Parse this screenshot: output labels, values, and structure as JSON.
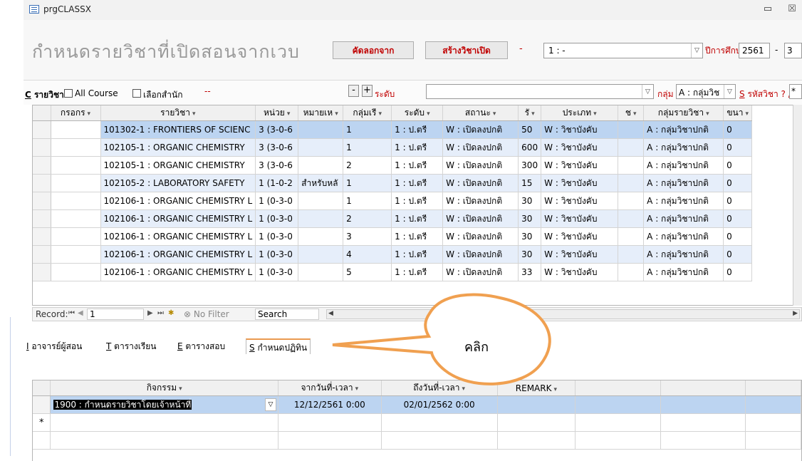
{
  "window": {
    "title": "prgCLASSX",
    "minimize_glyph": "▭",
    "close_glyph": "☒"
  },
  "header": {
    "title": "กำหนดรายวิชาที่เปิดสอนจากเวบ",
    "copy_button": "คัดลอกจาก",
    "create_button": "สร้างวิชาเปิด",
    "dash": "-",
    "combo_value": "1 : -",
    "year_label": "ปีการศึกษา",
    "year_value": "2561",
    "year_dash": "-",
    "term_value": "3"
  },
  "filters": {
    "subject_label_key": "C",
    "subject_label": " รายวิชา",
    "all_course": "All Course",
    "select_office": "เลือกสำนัก",
    "office_value": "--",
    "minus": "-",
    "plus": "+",
    "level_label": "ระดับ",
    "level_value": "",
    "group_label": "กลุ่ม",
    "group_value": "A : กลุ่มวิช",
    "code_label_key": "S",
    "code_label": " รหัสวิชา ? /*",
    "code_value": "*"
  },
  "grid": {
    "columns": [
      "กรอกร",
      "รายวิชา",
      "หน่วย",
      "หมายเห",
      "กลุ่มเรี",
      "ระดับ",
      "สถานะ",
      "รั",
      "ประเภท",
      "ช",
      "กลุ่มรายวิชา",
      "ขนา"
    ],
    "rows": [
      [
        "",
        "101302-1 : FRONTIERS OF SCIENC",
        "3 (3-0-6",
        "",
        "1",
        "1 : ป.ตรี",
        "W : เปิดลงปกติ",
        "50",
        "W : วิชาบังคับ",
        "",
        "A : กลุ่มวิชาปกติ",
        "0"
      ],
      [
        "",
        "102105-1 : ORGANIC CHEMISTRY",
        "3 (3-0-6",
        "",
        "1",
        "1 : ป.ตรี",
        "W : เปิดลงปกติ",
        "600",
        "W : วิชาบังคับ",
        "",
        "A : กลุ่มวิชาปกติ",
        "0"
      ],
      [
        "",
        "102105-1 : ORGANIC CHEMISTRY",
        "3 (3-0-6",
        "",
        "2",
        "1 : ป.ตรี",
        "W : เปิดลงปกติ",
        "300",
        "W : วิชาบังคับ",
        "",
        "A : กลุ่มวิชาปกติ",
        "0"
      ],
      [
        "",
        "102105-2 : LABORATORY SAFETY",
        "1 (1-0-2",
        "สำหรับหลั",
        "1",
        "1 : ป.ตรี",
        "W : เปิดลงปกติ",
        "15",
        "W : วิชาบังคับ",
        "",
        "A : กลุ่มวิชาปกติ",
        "0"
      ],
      [
        "",
        "102106-1 : ORGANIC CHEMISTRY L",
        "1 (0-3-0",
        "",
        "1",
        "1 : ป.ตรี",
        "W : เปิดลงปกติ",
        "30",
        "W : วิชาบังคับ",
        "",
        "A : กลุ่มวิชาปกติ",
        "0"
      ],
      [
        "",
        "102106-1 : ORGANIC CHEMISTRY L",
        "1 (0-3-0",
        "",
        "2",
        "1 : ป.ตรี",
        "W : เปิดลงปกติ",
        "30",
        "W : วิชาบังคับ",
        "",
        "A : กลุ่มวิชาปกติ",
        "0"
      ],
      [
        "",
        "102106-1 : ORGANIC CHEMISTRY L",
        "1 (0-3-0",
        "",
        "3",
        "1 : ป.ตรี",
        "W : เปิดลงปกติ",
        "30",
        "W : วิชาบังคับ",
        "",
        "A : กลุ่มวิชาปกติ",
        "0"
      ],
      [
        "",
        "102106-1 : ORGANIC CHEMISTRY L",
        "1 (0-3-0",
        "",
        "4",
        "1 : ป.ตรี",
        "W : เปิดลงปกติ",
        "30",
        "W : วิชาบังคับ",
        "",
        "A : กลุ่มวิชาปกติ",
        "0"
      ],
      [
        "",
        "102106-1 : ORGANIC CHEMISTRY L",
        "1 (0-3-0",
        "",
        "5",
        "1 : ป.ตรี",
        "W : เปิดลงปกติ",
        "33",
        "W : วิชาบังคับ",
        "",
        "A : กลุ่มวิชาปกติ",
        "0"
      ]
    ]
  },
  "record_nav": {
    "label": "Record:",
    "current": "1",
    "no_filter": "No Filter",
    "search": "Search"
  },
  "tabs": [
    {
      "key": "I",
      "label": " อาจารย์ผู้สอน"
    },
    {
      "key": "T",
      "label": " ตารางเรียน"
    },
    {
      "key": "E",
      "label": " ตารางสอบ"
    },
    {
      "key": "S",
      "label": " กำหนดปฏิทิน"
    }
  ],
  "schedule": {
    "columns": [
      "กิจกรรม",
      "จากวันที่-เวลา",
      "ถึงวันที่-เวลา",
      "REMARK"
    ],
    "rows": [
      [
        "1900 : กำหนดรายวิชาโดยเจ้าหน้าที่",
        "12/12/2561 0:00",
        "02/01/2562 0:00",
        ""
      ]
    ],
    "new_row_marker": "*"
  },
  "callout": {
    "text": "คลิก",
    "color": "#f0a050"
  },
  "colors": {
    "accent_red": "#c00000",
    "selected_row": "#bcd4f1",
    "alt_row": "#e6eefa"
  }
}
